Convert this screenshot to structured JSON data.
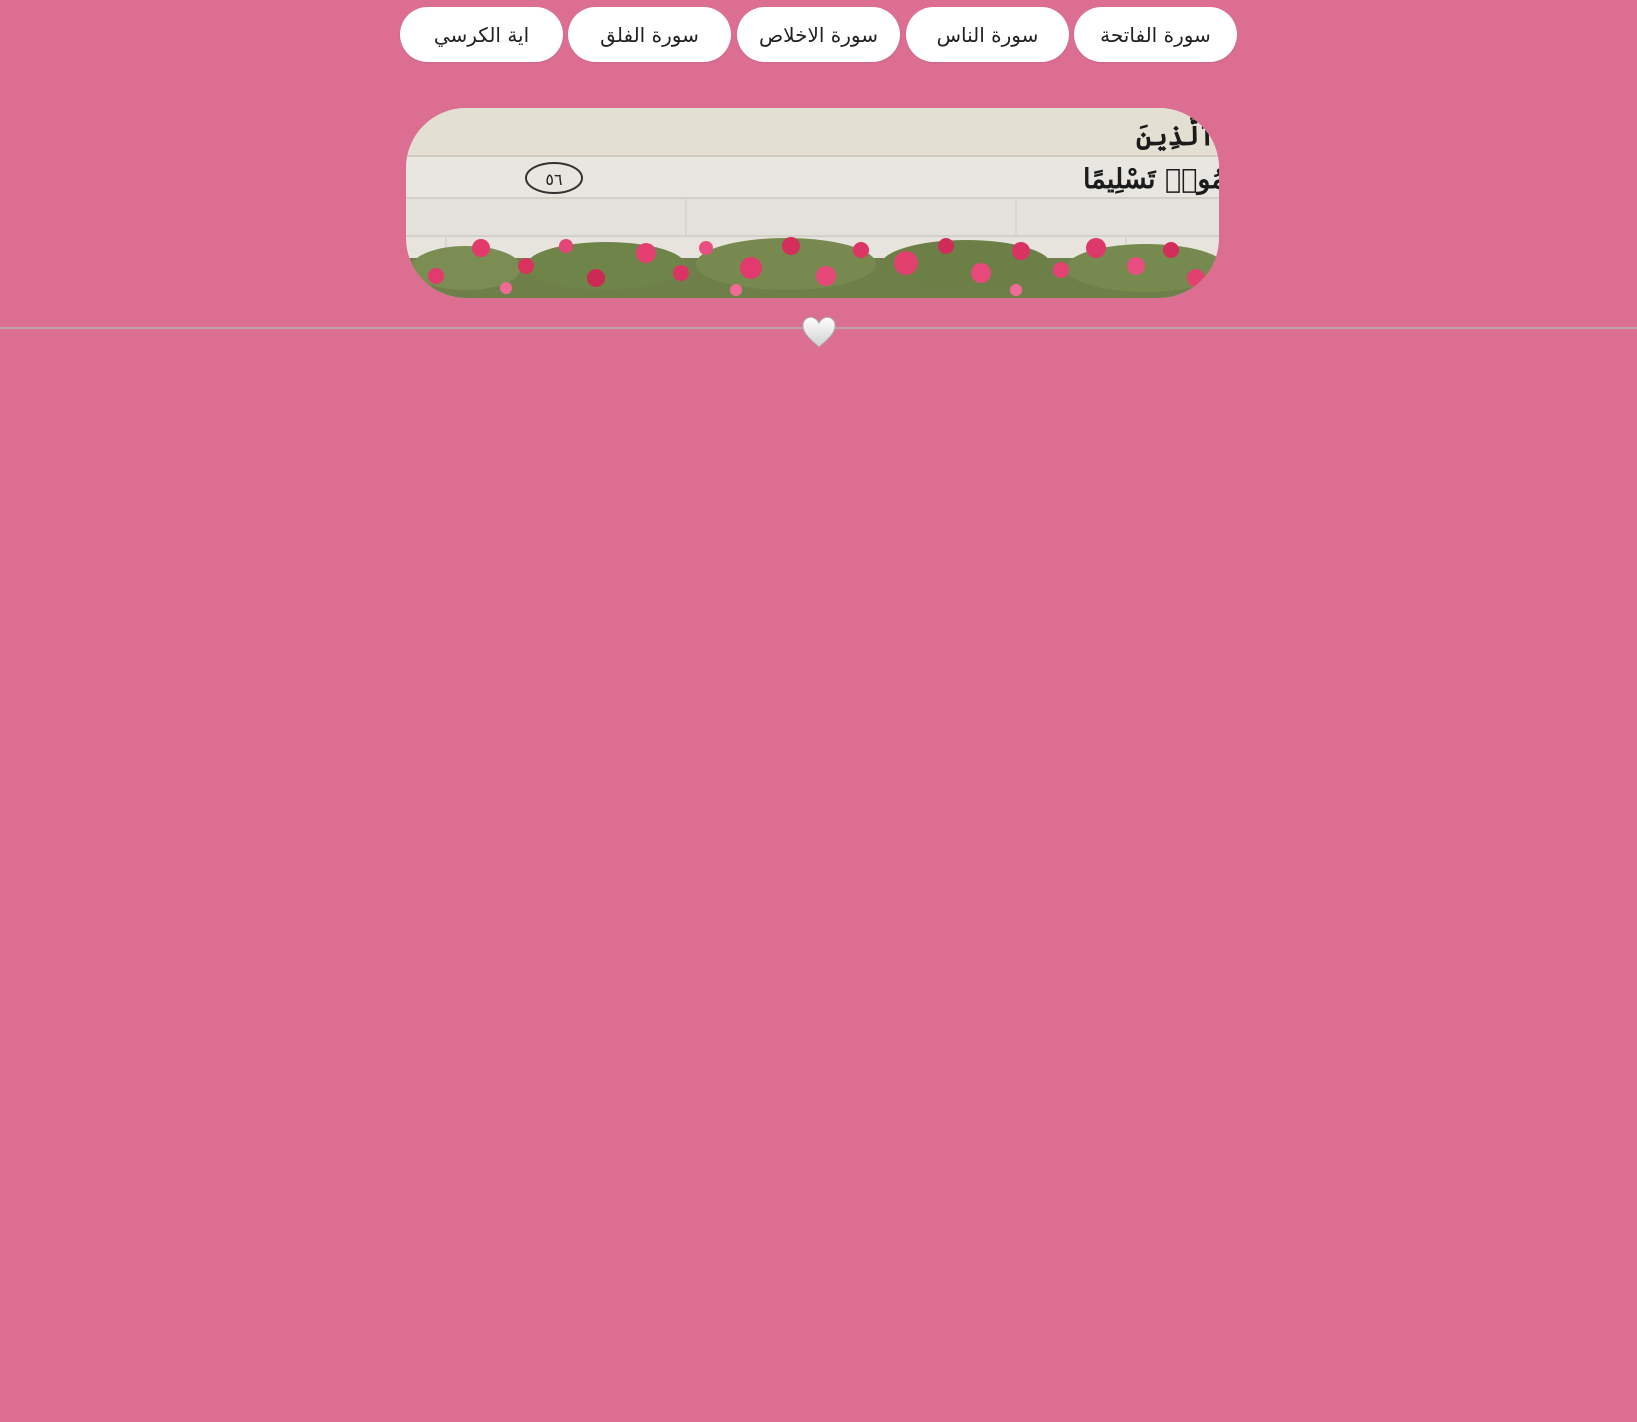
{
  "nav": {
    "buttons": [
      {
        "label": "سورة الفاتحة"
      },
      {
        "label": "سورة الناس"
      },
      {
        "label": "سورة الاخلاص"
      },
      {
        "label": "سورة الفلق"
      },
      {
        "label": "اية الكرسي"
      }
    ]
  },
  "banner": {
    "verse_line_1": "إِنَّ ٱللَّهَ وَمَلَٰٓئِكَتَهُۥ يُصَلُّونَ عَلَى ٱلنَّبِىِّ ۚ يَٰٓأَيُّهَا ٱلَّذِينَ",
    "verse_line_2": "ءَامَنُوا۟ صَلُّوا۟ عَلَيْهِ وَسَلِّمُوا۟ تَسْلِيمًا",
    "verse_number": "٥٦"
  },
  "colors": {
    "background": "#dc6f91",
    "button_bg": "#ffffff",
    "divider": "#b9a3aa"
  },
  "icons": {
    "divider_icon": "heart-icon"
  }
}
